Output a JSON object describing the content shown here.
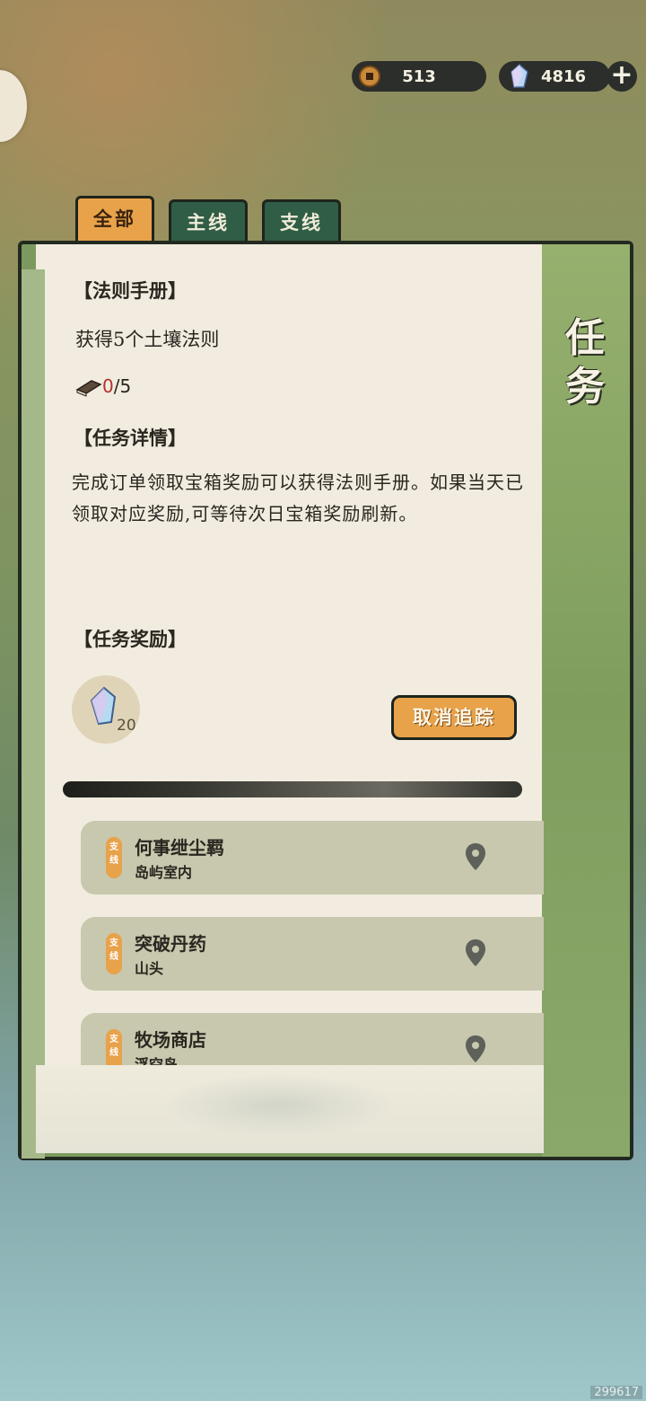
{
  "currency": {
    "coins": "513",
    "coin_icon": "coin-icon",
    "gems": "4816",
    "gem_icon": "crystal-icon",
    "add_icon": "plus-icon"
  },
  "tabs": [
    {
      "label": "全部",
      "active": true
    },
    {
      "label": "主线",
      "active": false
    },
    {
      "label": "支线",
      "active": false
    }
  ],
  "panel_title": "任务",
  "quest": {
    "name": "【法则手册】",
    "objective": "获得5个土壤法则",
    "progress_current": "0",
    "progress_total": "/5",
    "details_header": "【任务详情】",
    "details": "完成订单领取宝箱奖励可以获得法则手册。如果当天已领取对应奖励,可等待次日宝箱奖励刷新。",
    "rewards_header": "【任务奖励】",
    "reward_count": "20",
    "cancel_label": "取消追踪"
  },
  "quest_list": [
    {
      "tag": "支线",
      "name": "何事绁尘羁",
      "location": "岛屿室内"
    },
    {
      "tag": "支线",
      "name": "突破丹药",
      "location": "山头"
    },
    {
      "tag": "支线",
      "name": "牧场商店",
      "location": "浮空岛"
    }
  ],
  "watermark": "299617",
  "colors": {
    "accent": "#e8a24a",
    "tab_green": "#2f5d45",
    "paper": "#f1ecdf",
    "progress_red": "#b5312a"
  }
}
